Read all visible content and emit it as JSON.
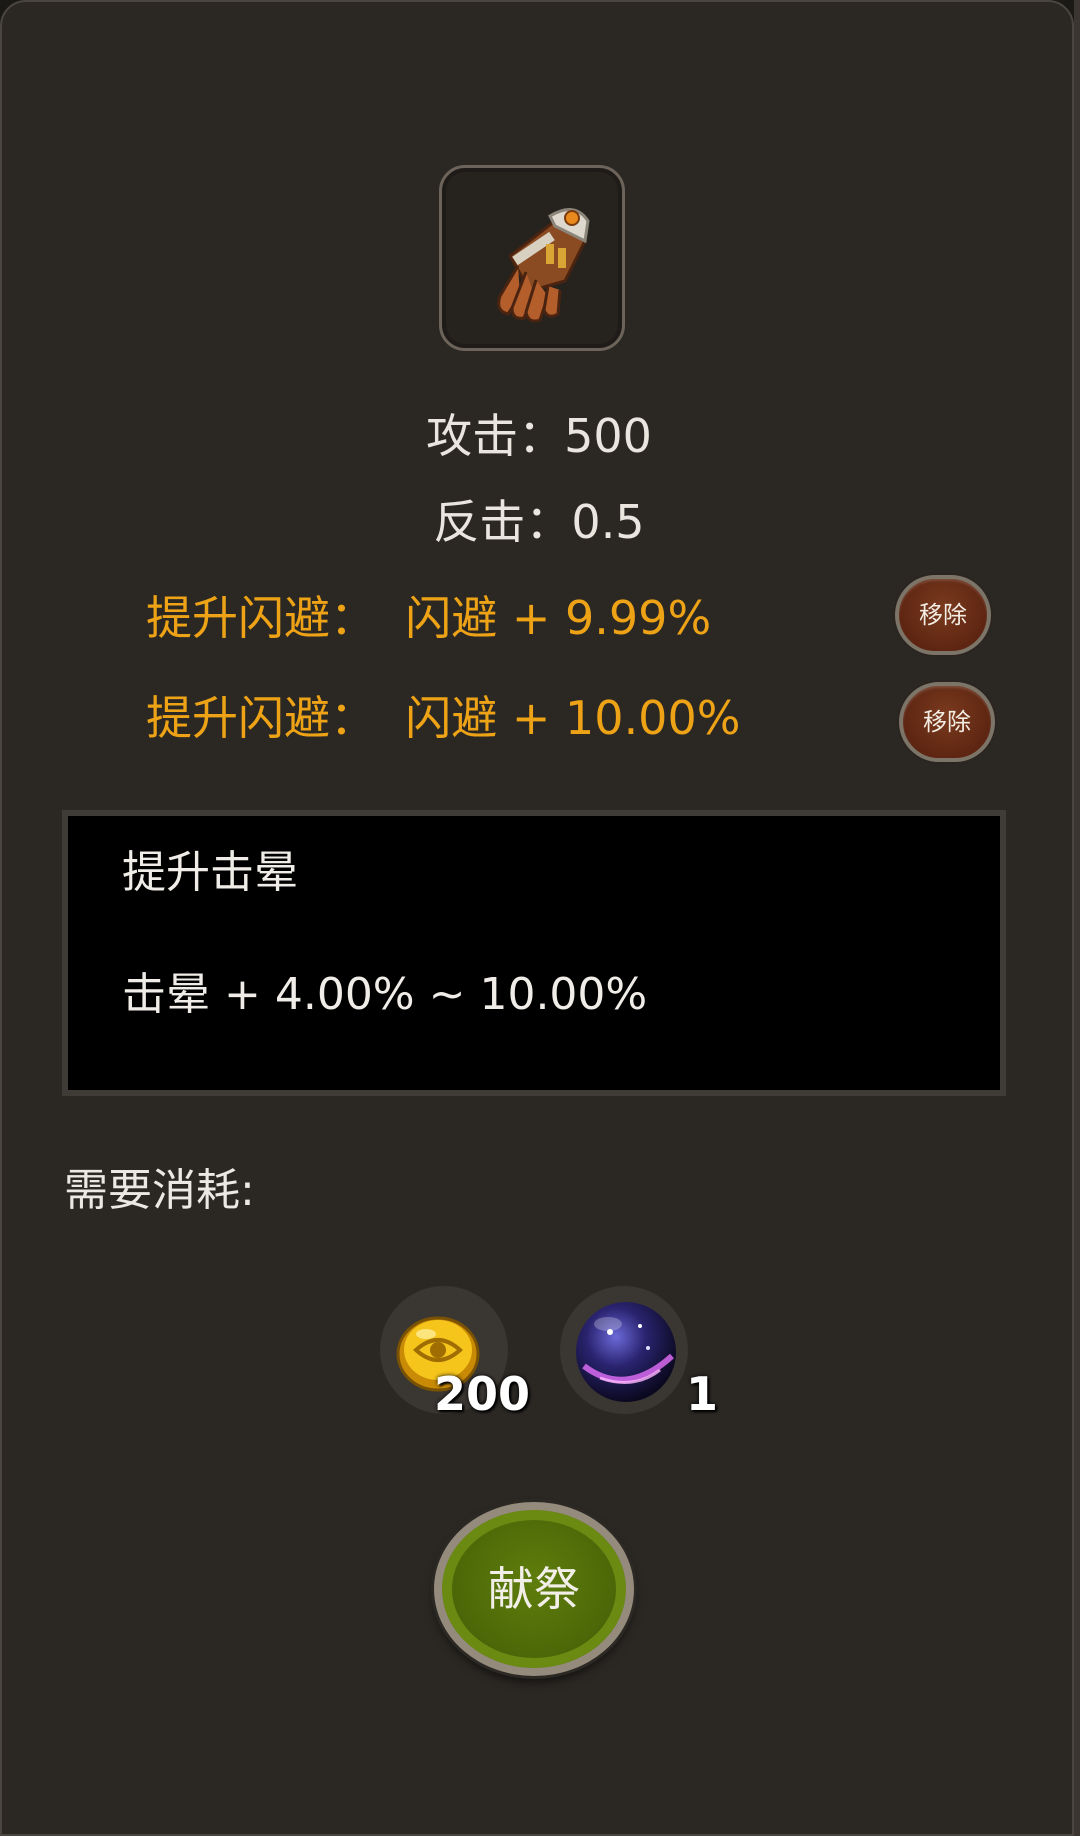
{
  "item": {
    "icon": "leather-gauntlet-icon"
  },
  "stats": {
    "attack": "攻击：500",
    "counter": "反击：0.5"
  },
  "affixes": [
    {
      "text": "提升闪避：  闪避 + 9.99%",
      "remove_label": "移除"
    },
    {
      "text": "提升闪避：  闪避 + 10.00%",
      "remove_label": "移除"
    }
  ],
  "description": {
    "title": "提升击晕",
    "body": "击晕 + 4.00% ~ 10.00%"
  },
  "cost": {
    "label": "需要消耗:",
    "items": [
      {
        "icon": "gold-coin-icon",
        "quantity": "200"
      },
      {
        "icon": "cosmic-orb-icon",
        "quantity": "1"
      }
    ]
  },
  "action": {
    "label": "献祭"
  },
  "colors": {
    "affix_text": "#eea316",
    "panel_bg": "#2b2824",
    "button_green": "#5f7d0c",
    "remove_button": "#6a2e17"
  }
}
